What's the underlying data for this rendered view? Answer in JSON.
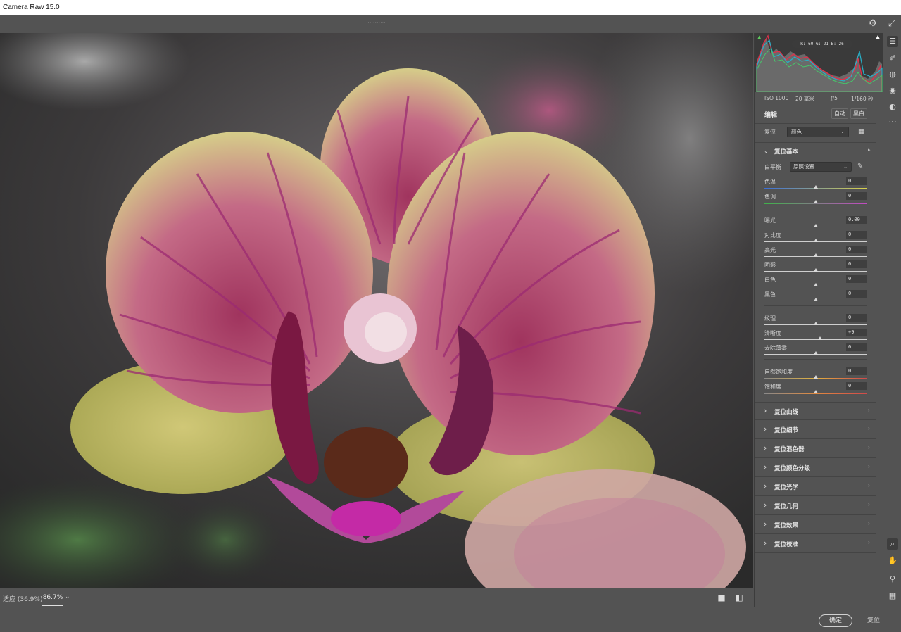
{
  "window": {
    "title": "Camera Raw 15.0"
  },
  "topbar": {
    "filename": "··········",
    "settings_icon": "gear-icon",
    "fullscreen_icon": "expand-icon"
  },
  "histogram": {
    "rgb_readout": "R: 60   G: 21   B: 26",
    "shadow_clip_icon": "triangle-up-icon",
    "highlight_clip_icon": "triangle-up-icon"
  },
  "exif": {
    "iso": "ISO 1000",
    "focal": "20 毫米",
    "aperture": "ƒ/5",
    "shutter": "1/160 秒"
  },
  "edit": {
    "title": "编辑",
    "auto_label": "自动",
    "bw_label": "黑白"
  },
  "profile": {
    "label": "复位",
    "value": "颜色"
  },
  "basic": {
    "section_name": "复位基本",
    "wb_label": "白平衡",
    "wb_value": "原照设置",
    "sliders": [
      {
        "label": "色温",
        "value": "0",
        "level": 0.5
      },
      {
        "label": "色调",
        "value": "0",
        "level": 0.5
      },
      {
        "label": "曝光",
        "value": "0.00",
        "level": 0.5
      },
      {
        "label": "对比度",
        "value": "0",
        "level": 0.5
      },
      {
        "label": "高光",
        "value": "0",
        "level": 0.5
      },
      {
        "label": "阴影",
        "value": "0",
        "level": 0.5
      },
      {
        "label": "白色",
        "value": "0",
        "level": 0.5
      },
      {
        "label": "黑色",
        "value": "0",
        "level": 0.5
      },
      {
        "label": "纹理",
        "value": "0",
        "level": 0.5
      },
      {
        "label": "清晰度",
        "value": "+9",
        "level": 0.545
      },
      {
        "label": "去除薄雾",
        "value": "0",
        "level": 0.5
      },
      {
        "label": "自然饱和度",
        "value": "0",
        "level": 0.5
      },
      {
        "label": "饱和度",
        "value": "0",
        "level": 0.5
      }
    ]
  },
  "sections": [
    {
      "name": "复位曲线"
    },
    {
      "name": "复位细节"
    },
    {
      "name": "复位混色器"
    },
    {
      "name": "复位颜色分级"
    },
    {
      "name": "复位光学"
    },
    {
      "name": "复位几何"
    },
    {
      "name": "复位效果"
    },
    {
      "name": "复位校准"
    }
  ],
  "bottom": {
    "zoom_fit": "适应 (36.9%)",
    "zoom_value": "86.7%"
  },
  "footer": {
    "ok_label": "确定",
    "reset_label": "复位"
  },
  "colors": {
    "accent": "#4ea3ff",
    "panel_bg": "#535353",
    "dark": "#3a3a3a"
  }
}
